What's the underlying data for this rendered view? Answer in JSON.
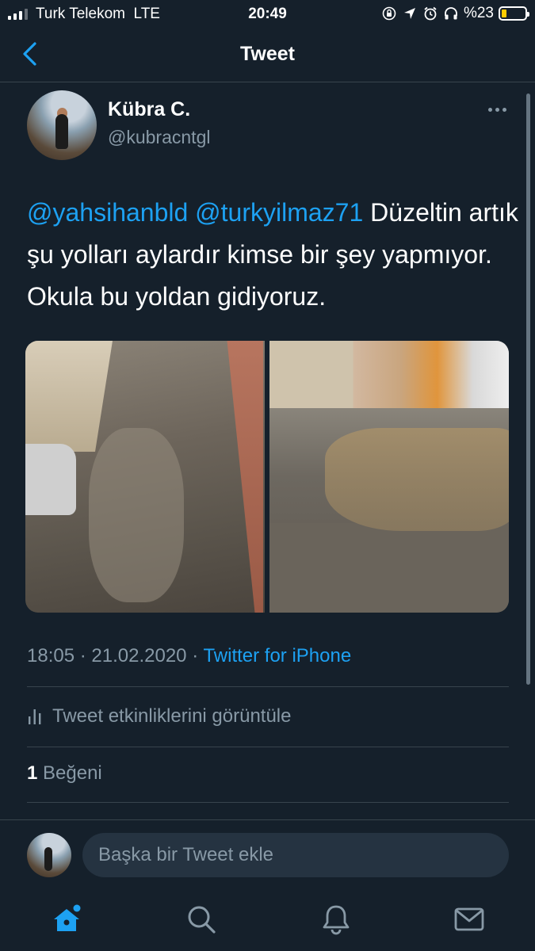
{
  "status_bar": {
    "carrier": "Turk Telekom",
    "network": "LTE",
    "time": "20:49",
    "battery_text": "%23",
    "battery_level": 0.23,
    "battery_color": "#ffcc00"
  },
  "nav": {
    "title": "Tweet"
  },
  "tweet": {
    "author_name": "Kübra C.",
    "author_handle": "@kubracntgl",
    "mention_1": "@yahsihanbld",
    "mention_2": "@turkyilmaz71",
    "body": "Düzeltin artık şu yolları aylardır kimse bir şey yapmıyor. Okula bu yoldan gidiyoruz.",
    "time": "18:05",
    "date": "21.02.2020",
    "separator": "·",
    "source": "Twitter for iPhone",
    "activity_label": "Tweet etkinliklerini görüntüle",
    "likes_count": "1",
    "likes_label": "Beğeni"
  },
  "reply": {
    "placeholder": "Başka bir Tweet ekle"
  },
  "colors": {
    "background": "#15202b",
    "accent": "#1da1f2",
    "secondary_text": "#8899a6",
    "divider": "#38444d"
  },
  "tabs": [
    {
      "name": "home",
      "icon": "home-icon"
    },
    {
      "name": "search",
      "icon": "search-icon"
    },
    {
      "name": "notifications",
      "icon": "bell-icon"
    },
    {
      "name": "messages",
      "icon": "mail-icon"
    }
  ]
}
